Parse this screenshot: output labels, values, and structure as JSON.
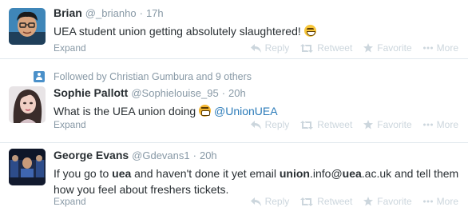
{
  "actions": {
    "reply": "Reply",
    "retweet": "Retweet",
    "favorite": "Favorite",
    "more": "More"
  },
  "tweets": [
    {
      "fullname": "Brian",
      "username": "@_brianho",
      "time": "17h",
      "text": "UEA student union getting absolutely slaughtered!",
      "expand": "Expand"
    },
    {
      "context": "Followed by Christian Gumbura and 9 others",
      "fullname": "Sophie Pallott",
      "username": "@Sophielouise_95",
      "time": "20h",
      "text": "What is the UEA union doing",
      "mention": "@UnionUEA",
      "expand": "Expand"
    },
    {
      "fullname": "George Evans",
      "username": "@Gdevans1",
      "time": "20h",
      "text_parts": [
        "If you go to ",
        "uea",
        " and haven't done it yet email ",
        "union",
        ".info@",
        "uea",
        ".ac.uk and tell them how you feel about freshers tickets."
      ],
      "expand": "Expand"
    }
  ],
  "colors": {
    "link": "#2b7bb9",
    "muted": "#8899a6",
    "action": "#ccd6dd",
    "text": "#292f33"
  }
}
